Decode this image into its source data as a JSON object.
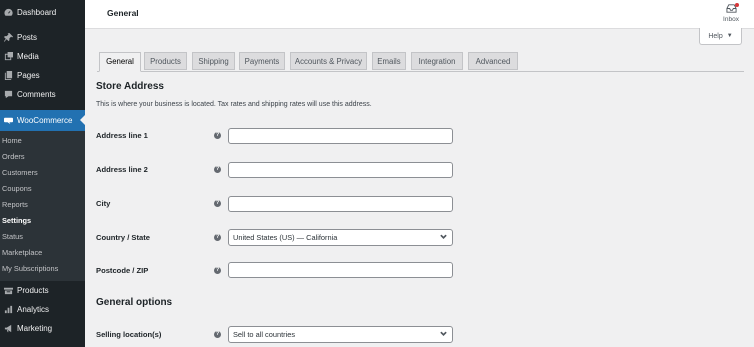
{
  "sidebar": {
    "top_items": [
      {
        "label": "Dashboard",
        "icon": "dashboard-icon"
      },
      {
        "label": "Posts",
        "icon": "pin-icon"
      },
      {
        "label": "Media",
        "icon": "media-icon"
      },
      {
        "label": "Pages",
        "icon": "pages-icon"
      },
      {
        "label": "Comments",
        "icon": "comment-icon"
      }
    ],
    "active": {
      "label": "WooCommerce",
      "icon": "woocommerce-icon"
    },
    "submenu": [
      "Home",
      "Orders",
      "Customers",
      "Coupons",
      "Reports",
      "Settings",
      "Status",
      "Marketplace",
      "My Subscriptions"
    ],
    "current_sub": "Settings",
    "bottom_items": [
      {
        "label": "Products",
        "icon": "products-icon"
      },
      {
        "label": "Analytics",
        "icon": "analytics-icon"
      },
      {
        "label": "Marketing",
        "icon": "megaphone-icon"
      }
    ]
  },
  "header": {
    "title": "General",
    "inbox_label": "Inbox",
    "help_label": "Help"
  },
  "tabs": [
    "General",
    "Products",
    "Shipping",
    "Payments",
    "Accounts & Privacy",
    "Emails",
    "Integration",
    "Advanced"
  ],
  "active_tab": "General",
  "store_address": {
    "title": "Store Address",
    "description": "This is where your business is located. Tax rates and shipping rates will use this address.",
    "fields": {
      "address1": {
        "label": "Address line 1",
        "value": ""
      },
      "address2": {
        "label": "Address line 2",
        "value": ""
      },
      "city": {
        "label": "City",
        "value": ""
      },
      "country": {
        "label": "Country / State",
        "value": "United States (US) — California"
      },
      "postcode": {
        "label": "Postcode / ZIP",
        "value": ""
      }
    }
  },
  "general_options": {
    "title": "General options",
    "selling_location": {
      "label": "Selling location(s)",
      "value": "Sell to all countries"
    }
  },
  "colors": {
    "accent": "#2271b1",
    "sidebar_bg": "#1d2327",
    "submenu_bg": "#2c3338"
  }
}
